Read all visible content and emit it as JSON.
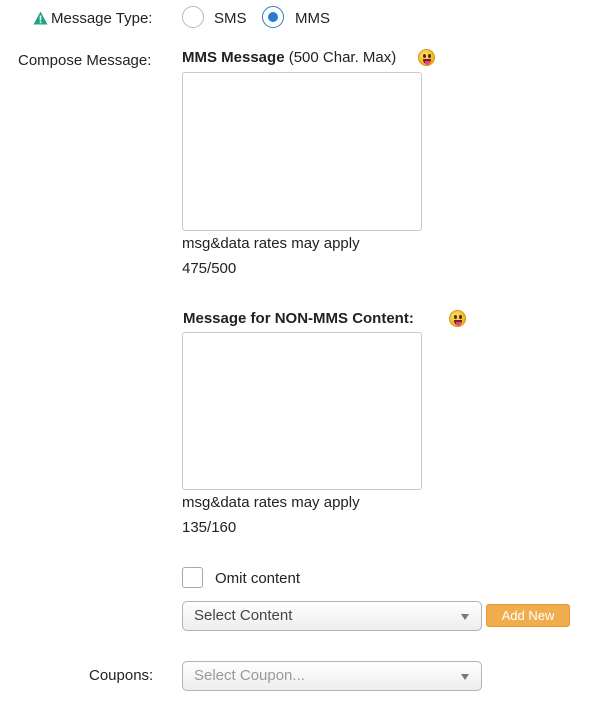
{
  "message_type": {
    "label": "Message Type:",
    "options": [
      {
        "label": "SMS",
        "checked": false
      },
      {
        "label": "MMS",
        "checked": true
      }
    ]
  },
  "compose": {
    "label": "Compose Message:",
    "mms": {
      "title_bold": "MMS Message",
      "title_rest": " (500 Char. Max)",
      "value": "",
      "rates_note": "msg&data rates may apply",
      "counter": "475/500"
    },
    "non_mms": {
      "title_bold": "Message for NON-MMS Content:",
      "value": "",
      "rates_note": "msg&data rates may apply",
      "counter": "135/160"
    }
  },
  "omit": {
    "label": "Omit content",
    "checked": false
  },
  "content_select": {
    "selected": "Select Content",
    "add_new_label": "Add New"
  },
  "coupons": {
    "label": "Coupons:",
    "selected": "Select Coupon..."
  },
  "icons": {
    "warning": "warning-icon",
    "emoji": "grinning-tongue-emoji-icon"
  },
  "colors": {
    "warning": "#1fa483",
    "radio_accent": "#2b7bd0",
    "add_new_button": "#f0ad4e"
  }
}
